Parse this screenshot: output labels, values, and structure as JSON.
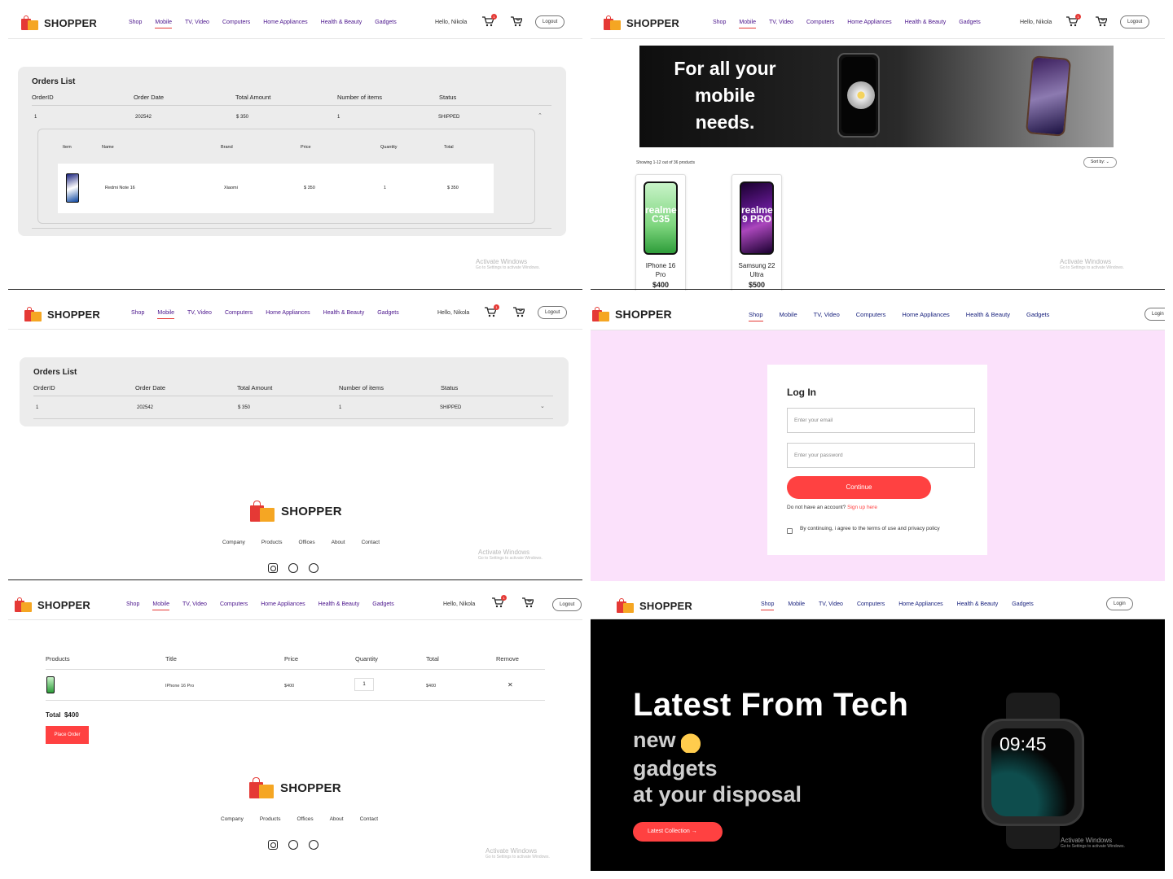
{
  "nav": {
    "logo": "SHOPPER",
    "items": [
      "Shop",
      "Mobile",
      "TV, Video",
      "Computers",
      "Home Appliances",
      "Health & Beauty",
      "Gadgets"
    ],
    "greeting": "Hello, Nikola",
    "logout": "Logout",
    "login": "Login",
    "cart_count": "1"
  },
  "orders": {
    "title": "Orders List",
    "columns": [
      "OrderID",
      "Order Date",
      "Total Amount",
      "Number of items",
      "Status"
    ],
    "row": {
      "id": "1",
      "date": "202542",
      "total": "$ 350",
      "items": "1",
      "status": "SHIPPED"
    },
    "item_columns": [
      "Item",
      "Name",
      "Brand",
      "Price",
      "Quantity",
      "Total"
    ],
    "item": {
      "name": "Redmi Note 16",
      "brand": "Xiaomi",
      "price": "$ 350",
      "quantity": "1",
      "total": "$ 350"
    }
  },
  "mobile": {
    "banner_lines": [
      "For all your",
      "mobile",
      "needs."
    ],
    "showing": "Showing 1-12 out of 36 products",
    "sort": "Sort by: ⌄",
    "products": [
      {
        "name_l1": "IPhone 16",
        "name_l2": "Pro",
        "price": "$400",
        "screen_text": "realme C35"
      },
      {
        "name_l1": "Samsung 22",
        "name_l2": "Ultra",
        "price": "$500",
        "screen_text": "realme 9 PRO"
      }
    ]
  },
  "footer": {
    "logo": "SHOPPER",
    "links": [
      "Company",
      "Products",
      "Offices",
      "About",
      "Contact"
    ],
    "social": [
      "instagram",
      "whatsapp",
      "pinterest"
    ]
  },
  "login": {
    "title": "Log In",
    "email_placeholder": "Enter your email",
    "password_placeholder": "Enter your password",
    "continue": "Continue",
    "no_account": "Do not have an account?",
    "signup": "Sign up here",
    "agree": "By continuing, i agree to the terms of use and privacy policy"
  },
  "cart": {
    "columns": [
      "Products",
      "Title",
      "Price",
      "Quantity",
      "Total",
      "Remove"
    ],
    "row": {
      "title": "IPhone 16 Pro",
      "price": "$400",
      "quantity": "1",
      "total": "$400",
      "remove": "✕"
    },
    "total_label": "Total",
    "total_value": "$400",
    "place_order": "Place Order"
  },
  "hero": {
    "title": "Latest From Tech",
    "line1": "new",
    "line2": "gadgets",
    "line3": "at your disposal",
    "button": "Latest Collection",
    "watch_time": "09:45"
  },
  "watermark": {
    "title": "Activate Windows",
    "sub": "Go to Settings to activate Windows."
  },
  "colors": {
    "accent": "#ff4141",
    "nav_text": "#4a148c",
    "login_bg": "#fbe1fb"
  }
}
